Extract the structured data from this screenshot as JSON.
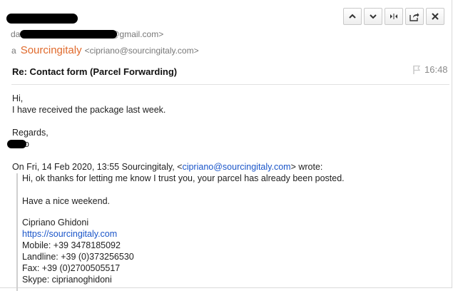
{
  "header": {
    "from_prefix": "da",
    "from_domain": "@gmail.com>",
    "to_prefix": "a",
    "to_name": "Sourcingitaly",
    "to_email": "<cipriano@sourcingitaly.com>"
  },
  "toolbar": {
    "buttons": [
      {
        "name": "previous-message-button",
        "icon": "chevron-up-icon"
      },
      {
        "name": "next-message-button",
        "icon": "chevron-down-icon"
      },
      {
        "name": "collapse-button",
        "icon": "collapse-arrows-icon"
      },
      {
        "name": "forward-button",
        "icon": "share-icon"
      },
      {
        "name": "close-button",
        "icon": "close-icon"
      }
    ]
  },
  "subject": "Re: Contact form (Parcel Forwarding)",
  "time": "16:48",
  "flag_icon": "flag-icon",
  "body": {
    "greeting": "Hi,",
    "line1": "I have received the package last week.",
    "regards": "Regards,",
    "signature_suffix": "o"
  },
  "quote_header": {
    "prefix": "On Fri, 14 Feb 2020, 13:55 Sourcingitaly, <",
    "email": "cipriano@sourcingitaly.com",
    "suffix": "> wrote:"
  },
  "quote": {
    "line1": "Hi, ok thanks for letting me know I trust you, your parcel has already been posted.",
    "line2": "Have a nice weekend.",
    "name": "Cipriano Ghidoni",
    "website": "https://sourcingitaly.com",
    "mobile": "Mobile: +39 3478185092",
    "landline": "Landline: +39 (0)373256530",
    "fax": "Fax: +39 (0)2700505517",
    "skype": "Skype: ciprianoghidoni"
  },
  "colors": {
    "accent": "#e06a2c",
    "link": "#1a55c9",
    "muted": "#777777"
  }
}
